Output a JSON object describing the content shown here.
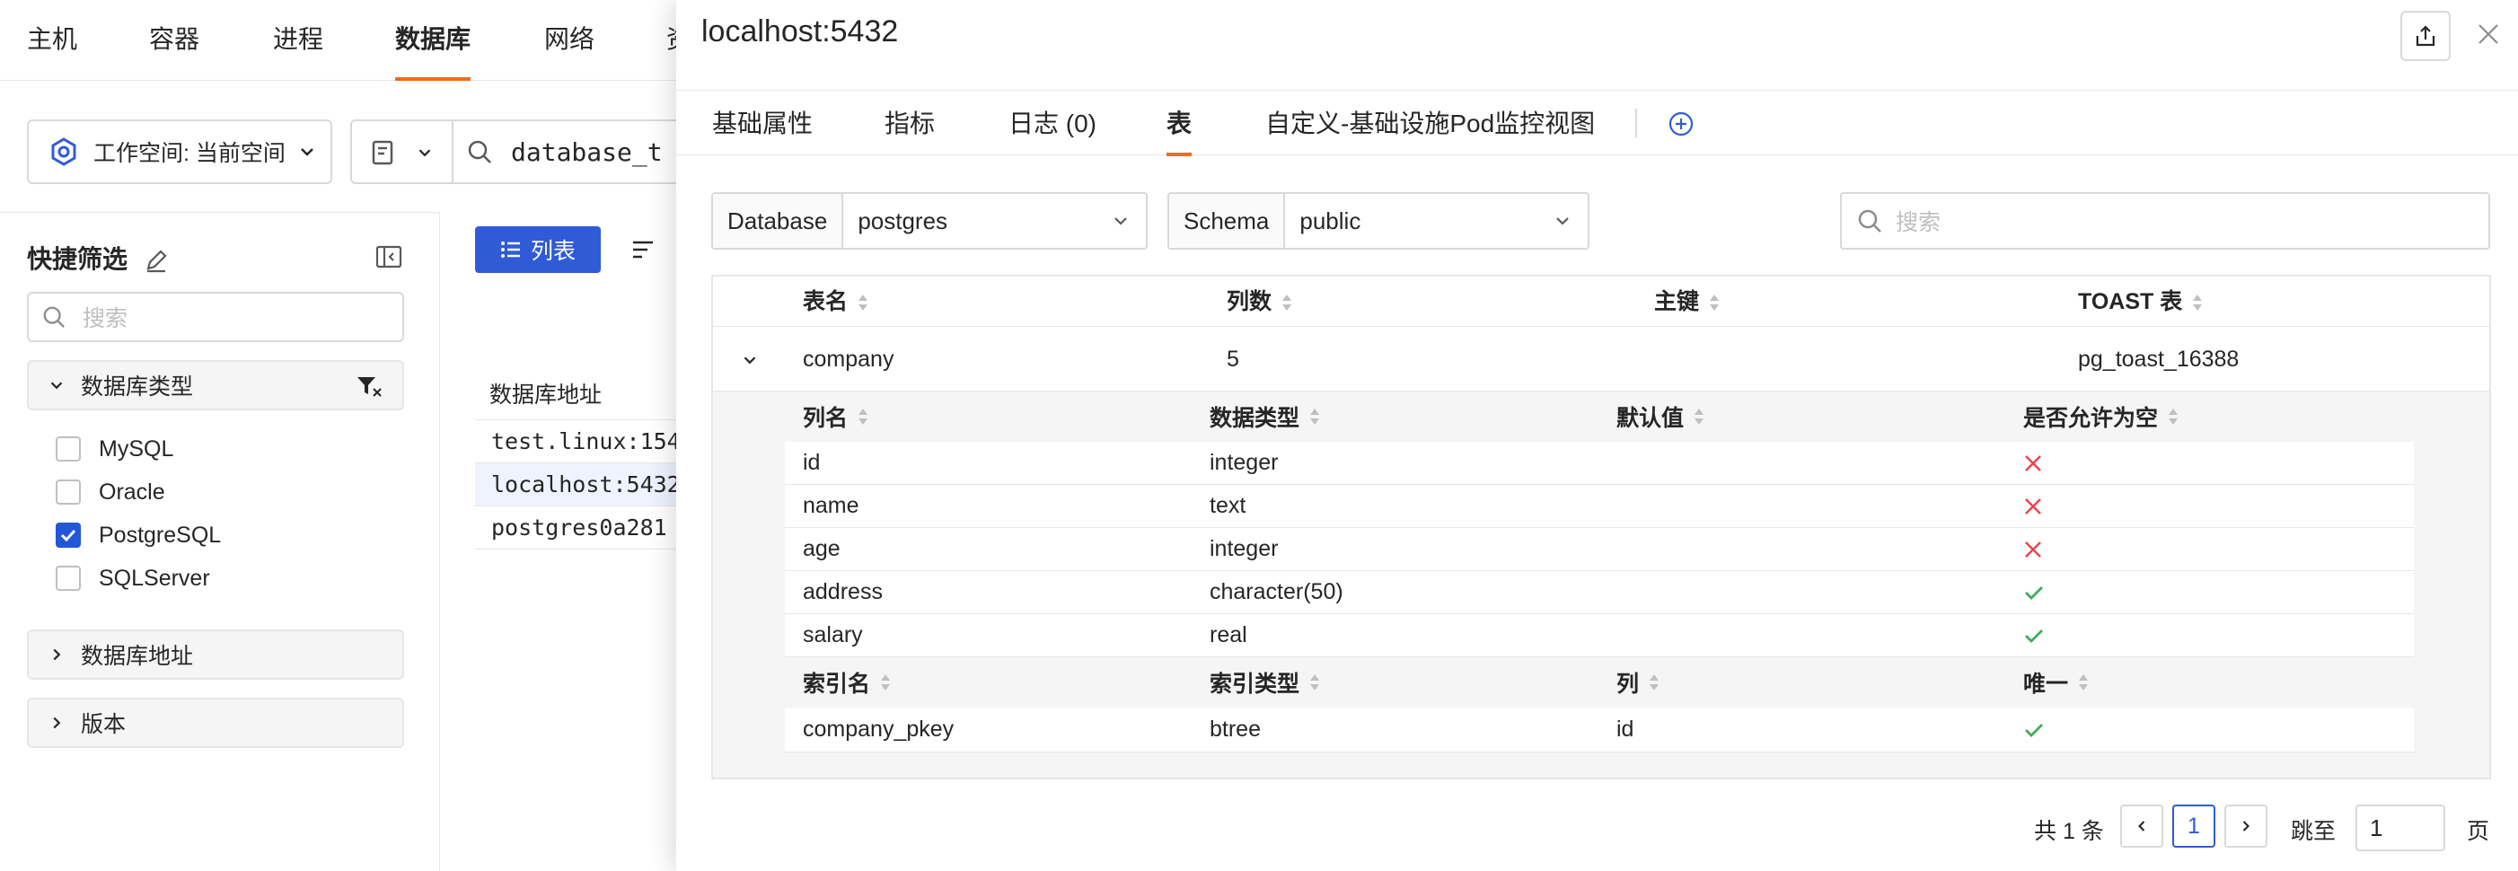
{
  "topnav": {
    "tabs": [
      "主机",
      "容器",
      "进程",
      "数据库",
      "网络",
      "资"
    ],
    "active": "数据库"
  },
  "filterbar": {
    "workspace_label": "工作空间: 当前空间",
    "search_value": "database_t"
  },
  "quick_filter": {
    "title": "快捷筛选",
    "search_placeholder": "搜索",
    "group_db_type": "数据库类型",
    "options": [
      {
        "label": "MySQL",
        "checked": false
      },
      {
        "label": "Oracle",
        "checked": false
      },
      {
        "label": "PostgreSQL",
        "checked": true
      },
      {
        "label": "SQLServer",
        "checked": false
      }
    ],
    "group_db_addr": "数据库地址",
    "group_version": "版本"
  },
  "list": {
    "list_button": "列表",
    "column_header": "数据库地址",
    "rows": [
      "test.linux:154",
      "localhost:5432",
      "postgres0a281"
    ]
  },
  "drawer": {
    "title": "localhost:5432",
    "tabs": [
      "基础属性",
      "指标",
      "日志 (0)",
      "表",
      "自定义-基础设施Pod监控视图"
    ],
    "active_tab": "表",
    "database_label": "Database",
    "database_value": "postgres",
    "schema_label": "Schema",
    "schema_value": "public",
    "search_placeholder": "搜索",
    "table_headers": [
      "表名",
      "列数",
      "主键",
      "TOAST 表"
    ],
    "table_row": {
      "name": "company",
      "columns": "5",
      "pk": "",
      "toast": "pg_toast_16388"
    },
    "column_headers": [
      "列名",
      "数据类型",
      "默认值",
      "是否允许为空"
    ],
    "columns": [
      {
        "name": "id",
        "type": "integer",
        "default": "",
        "nullable": false
      },
      {
        "name": "name",
        "type": "text",
        "default": "",
        "nullable": false
      },
      {
        "name": "age",
        "type": "integer",
        "default": "",
        "nullable": false
      },
      {
        "name": "address",
        "type": "character(50)",
        "default": "",
        "nullable": true
      },
      {
        "name": "salary",
        "type": "real",
        "default": "",
        "nullable": true
      }
    ],
    "index_headers": [
      "索引名",
      "索引类型",
      "列",
      "唯一"
    ],
    "indexes": [
      {
        "name": "company_pkey",
        "type": "btree",
        "column": "id",
        "unique": true
      }
    ],
    "pagination": {
      "total": "共 1 条",
      "current": "1",
      "jump_label": "跳至",
      "jump_value": "1",
      "page_suffix": "页"
    }
  },
  "colors": {
    "accent_orange": "#f26b1d",
    "primary_blue": "#2f5bd6",
    "cross_red": "#e8464b",
    "check_green": "#3fae5a"
  }
}
